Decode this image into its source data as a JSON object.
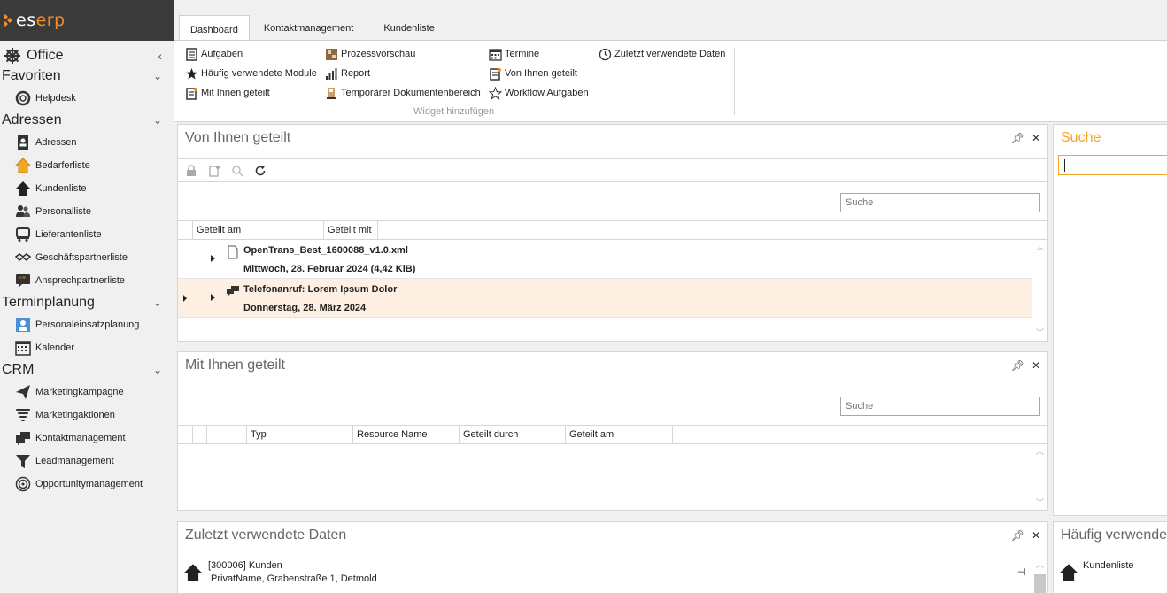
{
  "brand": {
    "name_part1": "es",
    "name_part2": "erp"
  },
  "sidebar": {
    "office": "Office",
    "groups": [
      {
        "label": "Favoriten",
        "items": [
          {
            "label": "Helpdesk",
            "icon": "lifebuoy-icon"
          }
        ]
      },
      {
        "label": "Adressen",
        "items": [
          {
            "label": "Adressen",
            "icon": "address-book-icon"
          },
          {
            "label": "Bedarferliste",
            "icon": "house-orange-icon"
          },
          {
            "label": "Kundenliste",
            "icon": "house-icon"
          },
          {
            "label": "Personalliste",
            "icon": "people-icon"
          },
          {
            "label": "Lieferantenliste",
            "icon": "truck-icon"
          },
          {
            "label": "Geschäftspartnerliste",
            "icon": "handshake-icon"
          },
          {
            "label": "Ansprechpartnerliste",
            "icon": "quote-icon"
          }
        ]
      },
      {
        "label": "Terminplanung",
        "items": [
          {
            "label": "Personaleinsatzplanung",
            "icon": "staff-plan-icon"
          },
          {
            "label": "Kalender",
            "icon": "calendar-icon"
          }
        ]
      },
      {
        "label": "CRM",
        "items": [
          {
            "label": "Marketingkampagne",
            "icon": "paper-plane-icon"
          },
          {
            "label": "Marketingaktionen",
            "icon": "tornado-icon"
          },
          {
            "label": "Kontaktmanagement",
            "icon": "chat-icon"
          },
          {
            "label": "Leadmanagement",
            "icon": "funnel-icon"
          },
          {
            "label": "Opportunitymanagement",
            "icon": "target-icon"
          }
        ]
      }
    ]
  },
  "tabs": [
    "Dashboard",
    "Kontaktmanagement",
    "Kundenliste"
  ],
  "ribbon": {
    "col1": [
      "Aufgaben",
      "Häufig verwendete Module",
      "Mit Ihnen geteilt"
    ],
    "col2": [
      "Prozessvorschau",
      "Report",
      "Temporärer Dokumentenbereich"
    ],
    "col3": [
      "Termine",
      "Von Ihnen geteilt",
      "Workflow Aufgaben"
    ],
    "col4": [
      "Zuletzt verwendete Daten"
    ],
    "group_label": "Widget hinzufügen"
  },
  "panel_shared_by_you": {
    "title": "Von Ihnen geteilt",
    "search_placeholder": "Suche",
    "columns": [
      "Geteilt am",
      "Geteilt mit"
    ],
    "rows": [
      {
        "line1": "OpenTrans_Best_1600088_v1.0.xml",
        "line2": "Mittwoch, 28. Februar 2024 (4,42 KiB)"
      },
      {
        "line1": "Telefonanruf: Lorem Ipsum Dolor",
        "line2": "Donnerstag, 28. März 2024"
      }
    ]
  },
  "panel_shared_with_you": {
    "title": "Mit Ihnen geteilt",
    "search_placeholder": "Suche",
    "columns": [
      "Typ",
      "Resource Name",
      "Geteilt durch",
      "Geteilt am"
    ]
  },
  "panel_recent": {
    "title": "Zuletzt verwendete Daten",
    "items": [
      {
        "line1": "[300006] Kunden",
        "line2": "PrivatName, Grabenstraße 1, Detmold"
      }
    ]
  },
  "panel_search": {
    "title": "Suche"
  },
  "panel_frequent": {
    "title": "Häufig verwende",
    "items": [
      "Kundenliste"
    ]
  },
  "colors": {
    "accent": "#f28c28",
    "selected_row": "#fdf0e2",
    "logo_bg": "#3a3a3a"
  }
}
